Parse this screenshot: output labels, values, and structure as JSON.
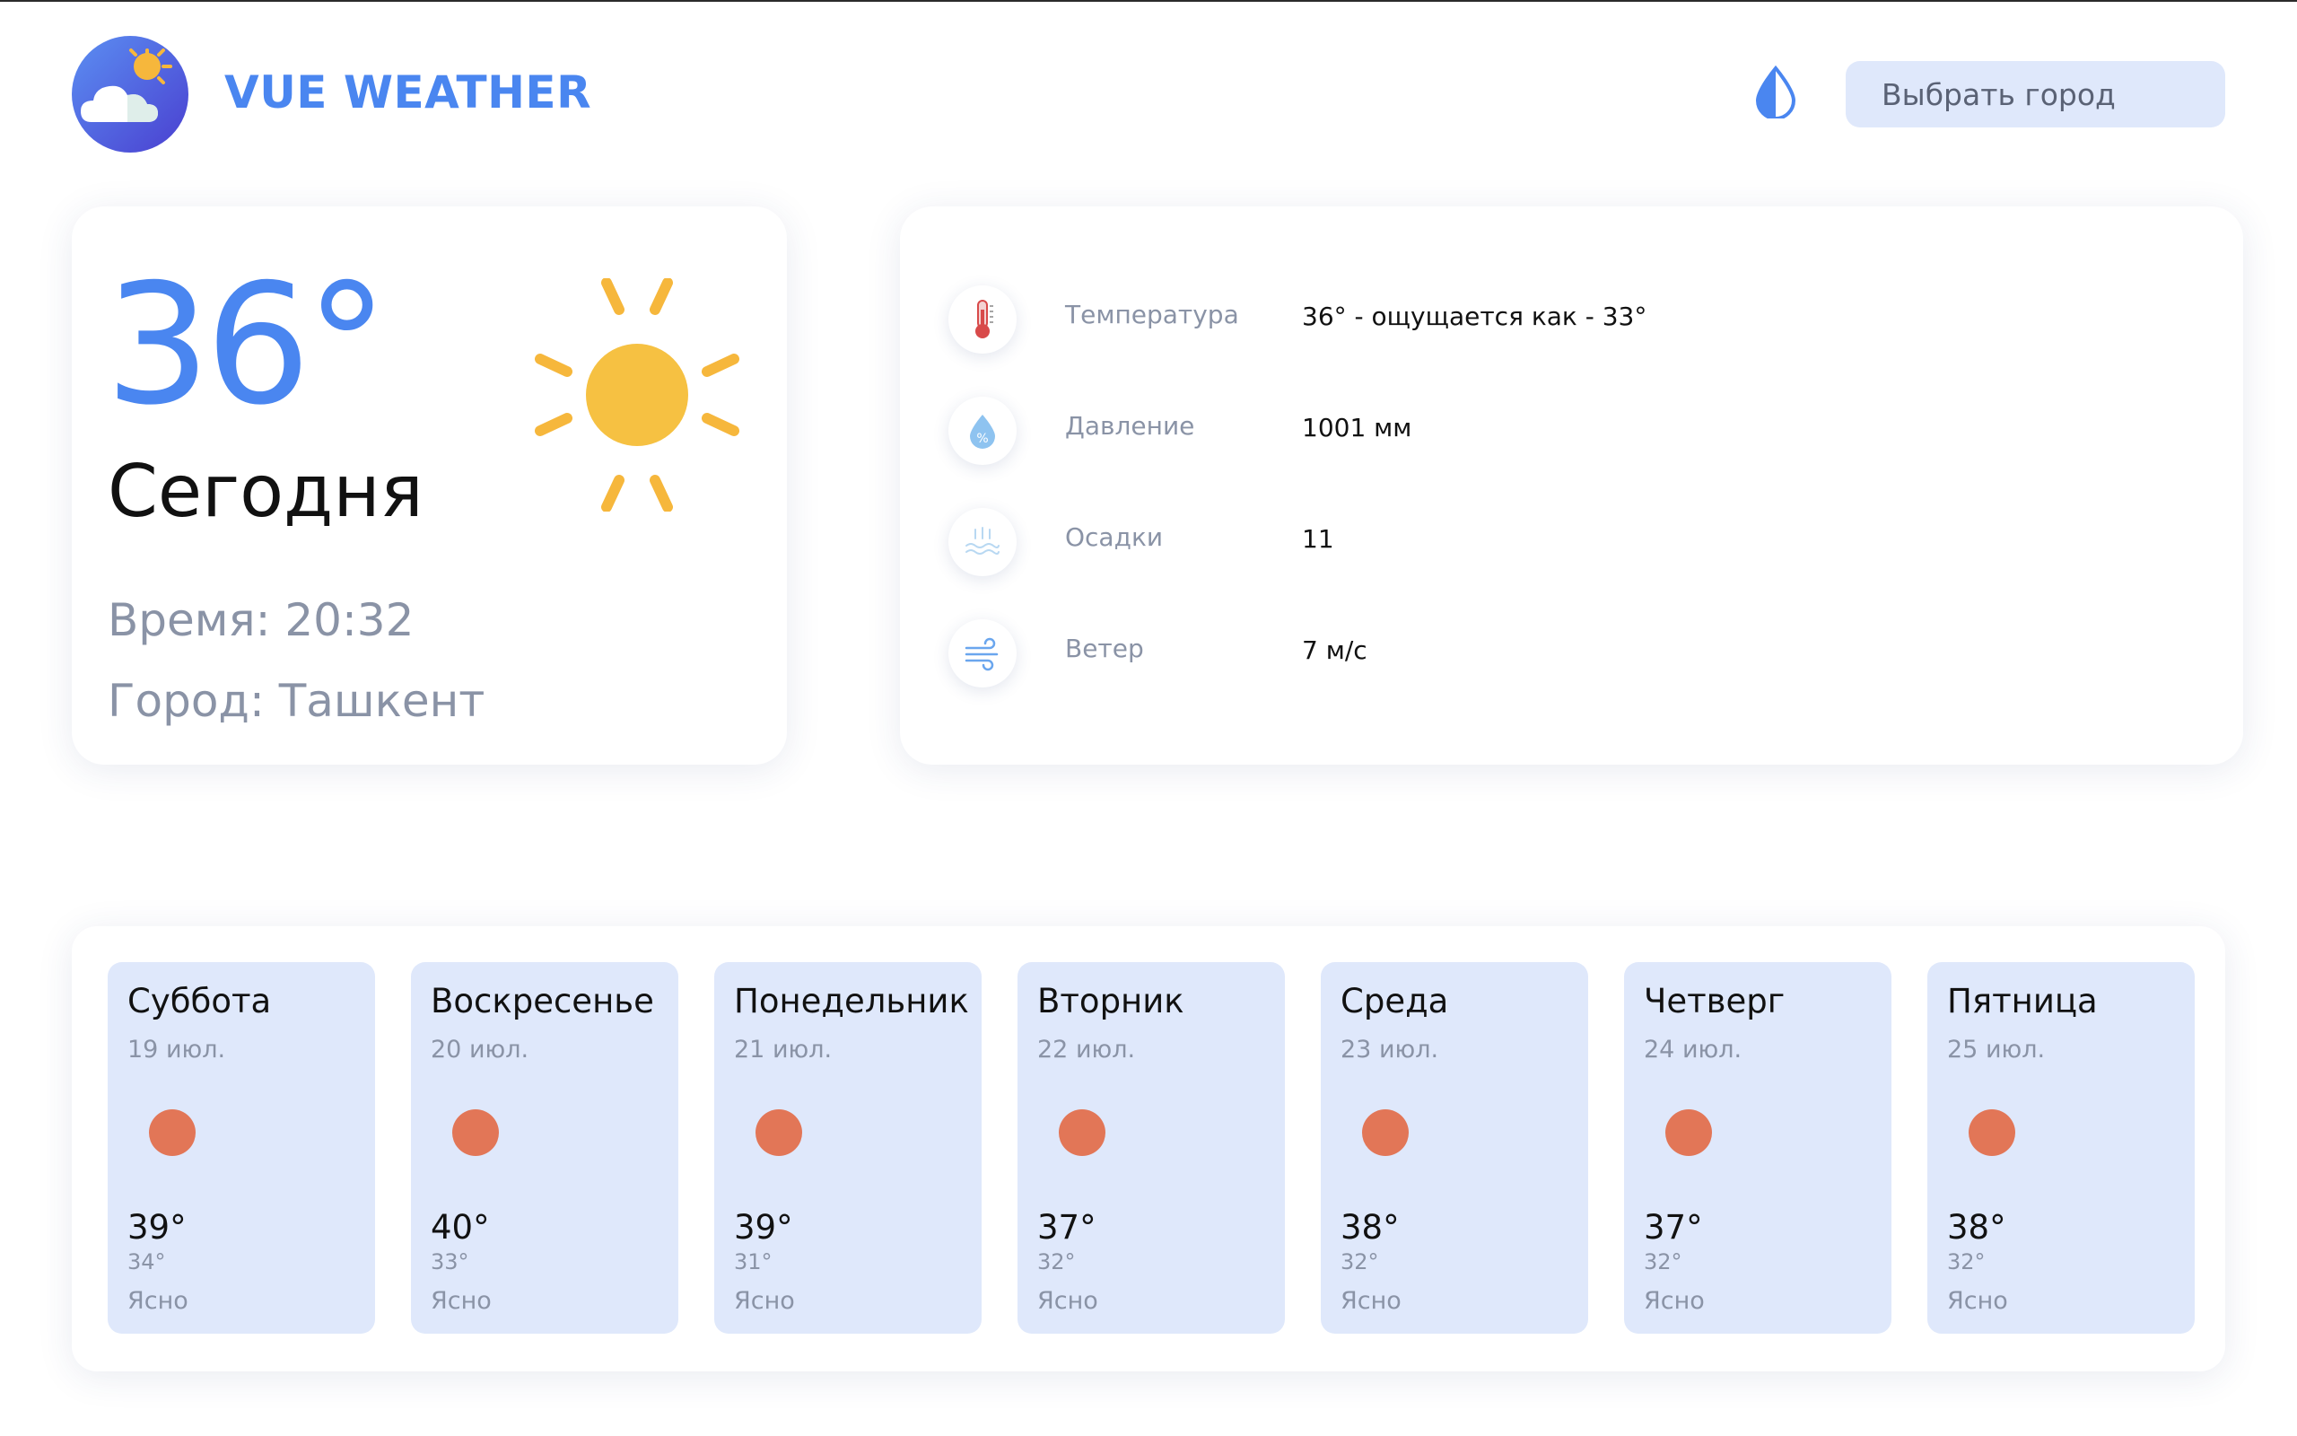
{
  "header": {
    "app_title": "VUE WEATHER",
    "city_button_label": "Выбрать город",
    "theme_icon": "drop-icon",
    "accent_color": "#4a86f0"
  },
  "today": {
    "temperature": "36°",
    "label": "Сегодня",
    "time": "Время: 20:32",
    "city": "Город: Ташкент",
    "icon": "sun-icon"
  },
  "details": [
    {
      "icon": "thermometer-icon",
      "label": "Температура",
      "value": "36° - ощущается как - 33°"
    },
    {
      "icon": "pressure-drop-icon",
      "label": "Давление",
      "value": "1001 мм"
    },
    {
      "icon": "precipitation-icon",
      "label": "Осадки",
      "value": "11"
    },
    {
      "icon": "wind-icon",
      "label": "Ветер",
      "value": "7 м/с"
    }
  ],
  "forecast": [
    {
      "day": "Суббота",
      "date": "19 июл.",
      "max": "39°",
      "min": "34°",
      "condition": "Ясно"
    },
    {
      "day": "Воскресенье",
      "date": "20 июл.",
      "max": "40°",
      "min": "33°",
      "condition": "Ясно"
    },
    {
      "day": "Понедельник",
      "date": "21 июл.",
      "max": "39°",
      "min": "31°",
      "condition": "Ясно"
    },
    {
      "day": "Вторник",
      "date": "22 июл.",
      "max": "37°",
      "min": "32°",
      "condition": "Ясно"
    },
    {
      "day": "Среда",
      "date": "23 июл.",
      "max": "38°",
      "min": "32°",
      "condition": "Ясно"
    },
    {
      "day": "Четверг",
      "date": "24 июл.",
      "max": "37°",
      "min": "32°",
      "condition": "Ясно"
    },
    {
      "day": "Пятница",
      "date": "25 июл.",
      "max": "38°",
      "min": "32°",
      "condition": "Ясно"
    }
  ],
  "colors": {
    "tile_background": "#dfe8fb",
    "sun_icon": "#e27657",
    "muted_text": "#8a93a6"
  }
}
